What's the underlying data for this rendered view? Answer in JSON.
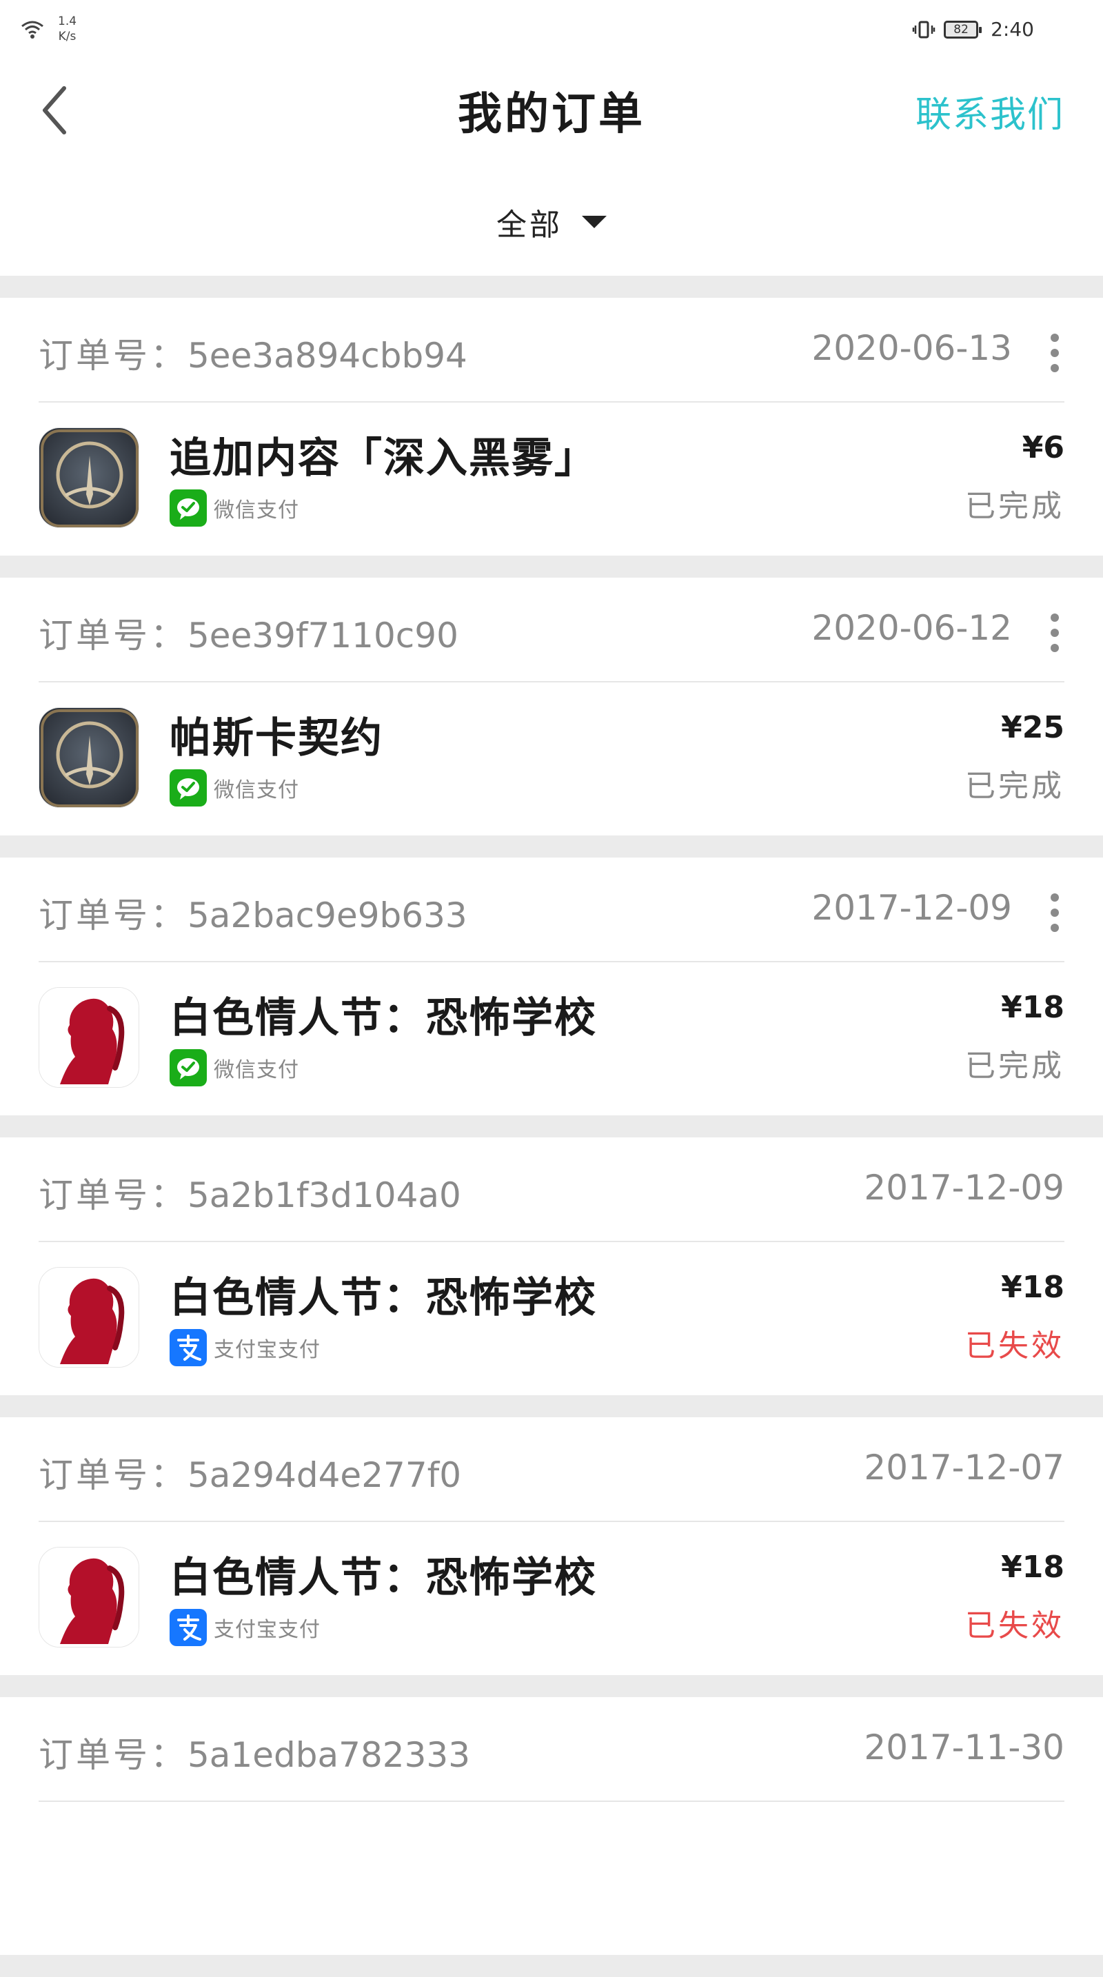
{
  "statusbar": {
    "speed_value": "1.4",
    "speed_unit": "K/s",
    "battery": "82",
    "time": "2:40"
  },
  "header": {
    "title": "我的订单",
    "contact_label": "联系我们"
  },
  "filter": {
    "selected": "全部"
  },
  "order_label": "订单号：",
  "orders": [
    {
      "order_no": "5ee3a894cbb94",
      "date": "2020-06-13",
      "has_menu": true,
      "app_icon": "dark-game-emblem",
      "title": "追加内容「深入黑雾」",
      "payment_method": "微信支付",
      "payment_icon": "wechat-pay-icon",
      "price": "¥6",
      "status": "已完成",
      "status_type": "completed"
    },
    {
      "order_no": "5ee39f7110c90",
      "date": "2020-06-12",
      "has_menu": true,
      "app_icon": "dark-game-emblem",
      "title": "帕斯卡契约",
      "payment_method": "微信支付",
      "payment_icon": "wechat-pay-icon",
      "price": "¥25",
      "status": "已完成",
      "status_type": "completed"
    },
    {
      "order_no": "5a2bac9e9b633",
      "date": "2017-12-09",
      "has_menu": true,
      "app_icon": "red-girl-silhouette",
      "title": "白色情人节：恐怖学校",
      "payment_method": "微信支付",
      "payment_icon": "wechat-pay-icon",
      "price": "¥18",
      "status": "已完成",
      "status_type": "completed"
    },
    {
      "order_no": "5a2b1f3d104a0",
      "date": "2017-12-09",
      "has_menu": false,
      "app_icon": "red-girl-silhouette",
      "title": "白色情人节：恐怖学校",
      "payment_method": "支付宝支付",
      "payment_icon": "alipay-icon",
      "price": "¥18",
      "status": "已失效",
      "status_type": "failed"
    },
    {
      "order_no": "5a294d4e277f0",
      "date": "2017-12-07",
      "has_menu": false,
      "app_icon": "red-girl-silhouette",
      "title": "白色情人节：恐怖学校",
      "payment_method": "支付宝支付",
      "payment_icon": "alipay-icon",
      "price": "¥18",
      "status": "已失效",
      "status_type": "failed"
    },
    {
      "order_no": "5a1edba782333",
      "date": "2017-11-30",
      "has_menu": false,
      "app_icon": "",
      "title": "",
      "payment_method": "",
      "payment_icon": "",
      "price": "",
      "status": "",
      "status_type": ""
    }
  ],
  "colors": {
    "accent": "#2cc2cc",
    "failed": "#e84a4a",
    "wechat": "#1aad19",
    "alipay": "#1677ff"
  }
}
